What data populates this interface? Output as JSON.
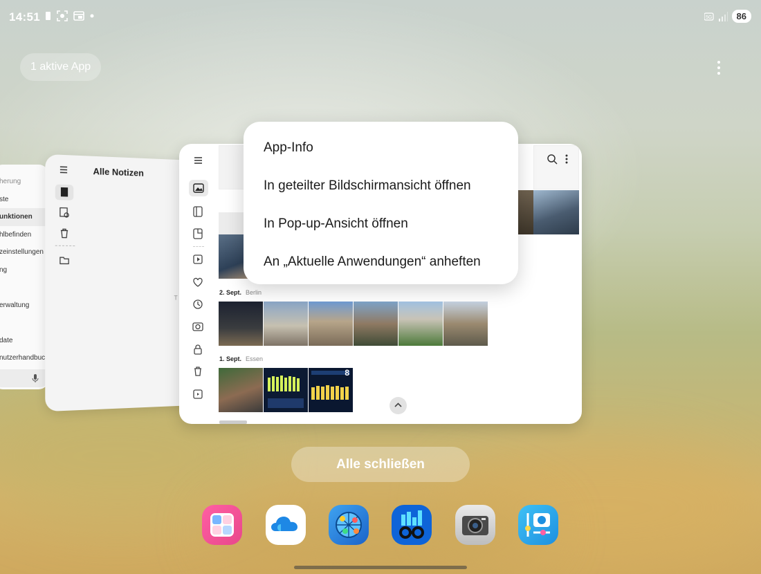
{
  "status_bar": {
    "time": "14:51",
    "battery": "86"
  },
  "recents": {
    "active_apps_label": "1 aktive App",
    "close_all_label": "Alle schließen"
  },
  "settings_card": {
    "items": [
      "herung",
      "ste",
      "unktionen",
      "hlbefinden",
      "zeinstellungen",
      "ng",
      "",
      "erwaltung",
      "",
      "date",
      "nutzerhandbuch"
    ]
  },
  "notes_card": {
    "title": "Alle Notizen"
  },
  "gallery_card": {
    "date1": "2. Sept.",
    "place1": "Berlin",
    "date2": "1. Sept.",
    "place2": "Essen",
    "counter": "8"
  },
  "context_menu": {
    "items": [
      "App-Info",
      "In geteilter Bildschirmansicht öffnen",
      "In Pop-up-Ansicht öffnen",
      "An „Aktuelle Anwendungen“ anheften"
    ]
  },
  "dock": {
    "apps": [
      "notes-app-icon",
      "onedrive-icon",
      "network-map-icon",
      "geekbench-icon",
      "camera-icon",
      "camera-settings-icon"
    ]
  },
  "colors": {
    "menu_bg": "#ffffff",
    "overlay_button": "rgba(255,255,255,0.3)"
  }
}
